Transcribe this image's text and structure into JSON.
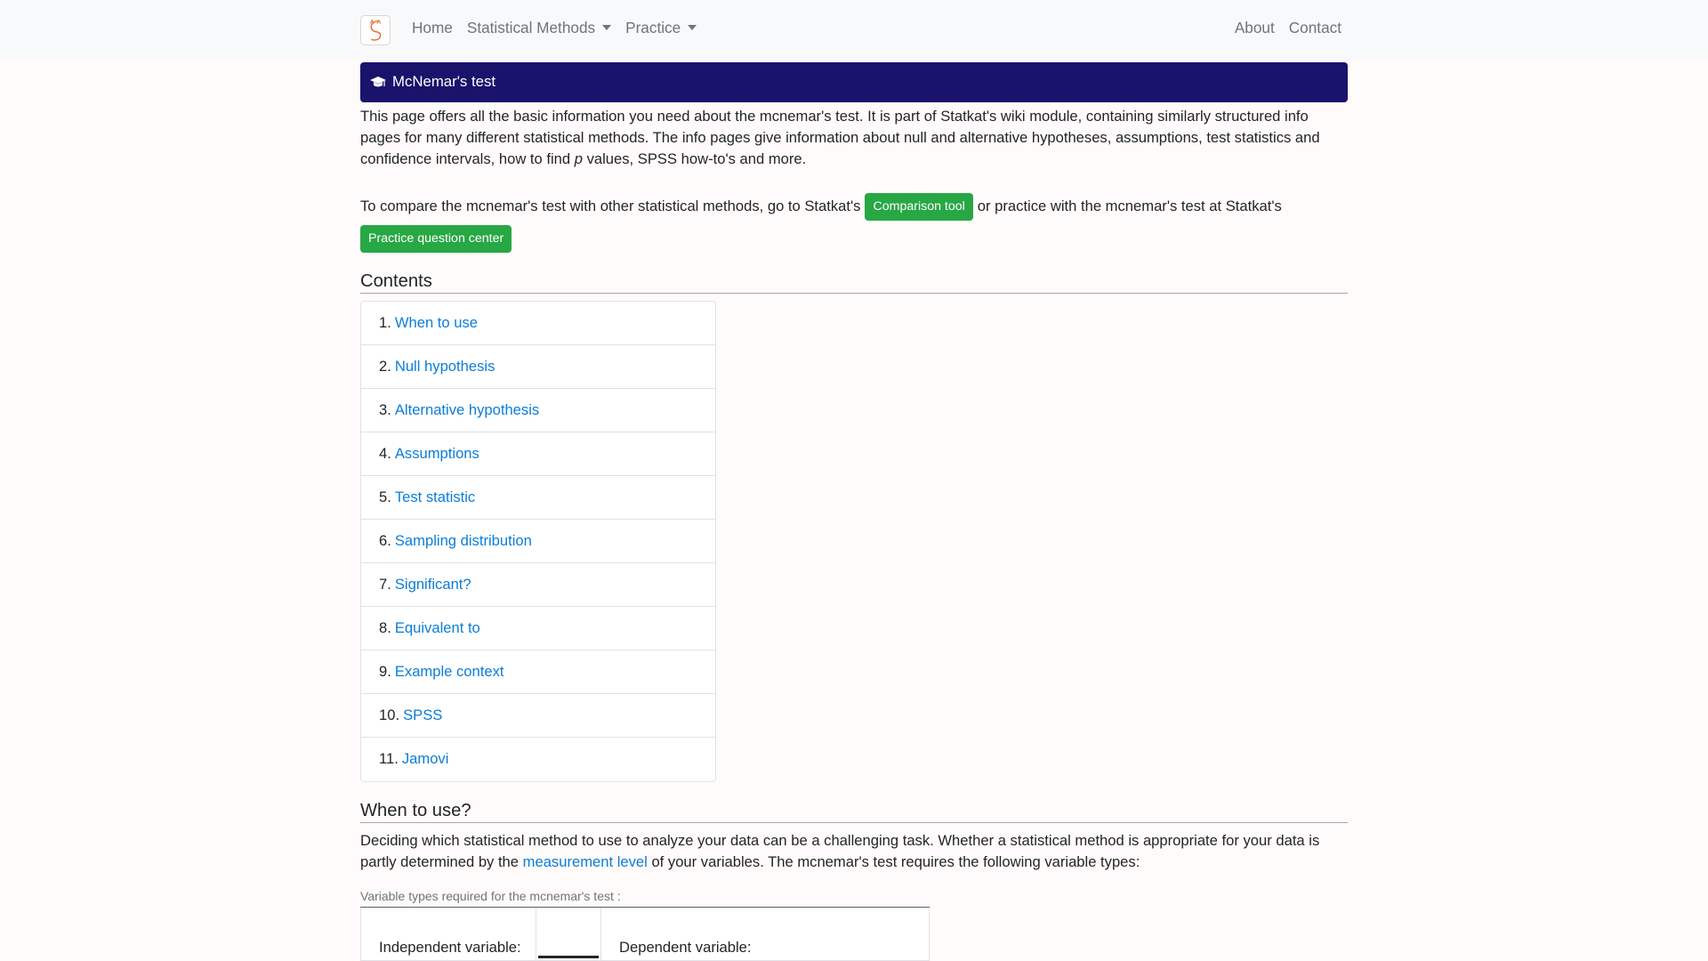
{
  "navbar": {
    "logo_icon": "statkat-logo-icon",
    "left_links": [
      {
        "label": "Home",
        "dropdown": false
      },
      {
        "label": "Statistical Methods",
        "dropdown": true
      },
      {
        "label": "Practice",
        "dropdown": true
      }
    ],
    "right_links": [
      {
        "label": "About"
      },
      {
        "label": "Contact"
      }
    ]
  },
  "banner": {
    "icon": "graduation-cap-icon",
    "title": "McNemar's test",
    "color": "#1a136b"
  },
  "intro": {
    "text_before_p": "This page offers all the basic information you need about the mcnemar's test. It is part of Statkat's wiki module, containing similarly structured info pages for many different statistical methods. The info pages give information about null and alternative hypotheses, assumptions, test statistics and confidence intervals, how to find ",
    "p_italic": "p",
    "text_after_p": " values, SPSS how-to's and more."
  },
  "compare": {
    "text_before": "To compare the mcnemar's test with other statistical methods, go to Statkat's",
    "comparison_button": "Comparison tool",
    "text_middle": "or practice with the mcnemar's test at Statkat's",
    "practice_button": "Practice question center",
    "button_color": "#28a745"
  },
  "contents": {
    "heading": "Contents",
    "items": [
      {
        "num": "1.",
        "label": "When to use"
      },
      {
        "num": "2.",
        "label": "Null hypothesis"
      },
      {
        "num": "3.",
        "label": "Alternative hypothesis"
      },
      {
        "num": "4.",
        "label": "Assumptions"
      },
      {
        "num": "5.",
        "label": "Test statistic"
      },
      {
        "num": "6.",
        "label": "Sampling distribution"
      },
      {
        "num": "7.",
        "label": "Significant?"
      },
      {
        "num": "8.",
        "label": "Equivalent to"
      },
      {
        "num": "9.",
        "label": "Example context"
      },
      {
        "num": "10.",
        "label": "SPSS"
      },
      {
        "num": "11.",
        "label": "Jamovi"
      }
    ]
  },
  "when_to_use": {
    "heading": "When to use?",
    "text_before_link": "Deciding which statistical method to use to analyze your data can be a challenging task. Whether a statistical method is appropriate for your data is partly determined by the ",
    "link": "measurement level",
    "text_after_link": " of your variables. The mcnemar's test requires the following variable types:",
    "table_caption": "Variable types required for the mcnemar's test :",
    "independent_label": "Independent variable:",
    "dependent_label": "Dependent variable:"
  },
  "link_color": "#0b7dd6"
}
